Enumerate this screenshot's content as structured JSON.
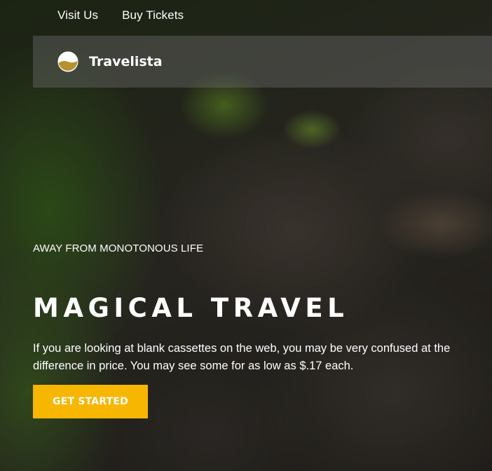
{
  "nav": {
    "items": [
      {
        "label": "Visit Us"
      },
      {
        "label": "Buy Tickets"
      }
    ]
  },
  "brand": {
    "name": "Travelista",
    "logo_icon": "sun-desert-icon"
  },
  "hero": {
    "eyebrow": "AWAY FROM MONOTONOUS LIFE",
    "title": "MAGICAL TRAVEL",
    "description": "If you are looking at blank cassettes on the web, you may be very confused at the difference in price. You may see some for as low as $.17 each.",
    "cta_label": "GET STARTED"
  },
  "colors": {
    "accent": "#f7b600",
    "logo_gold": "#b7902f",
    "text": "#ffffff"
  }
}
